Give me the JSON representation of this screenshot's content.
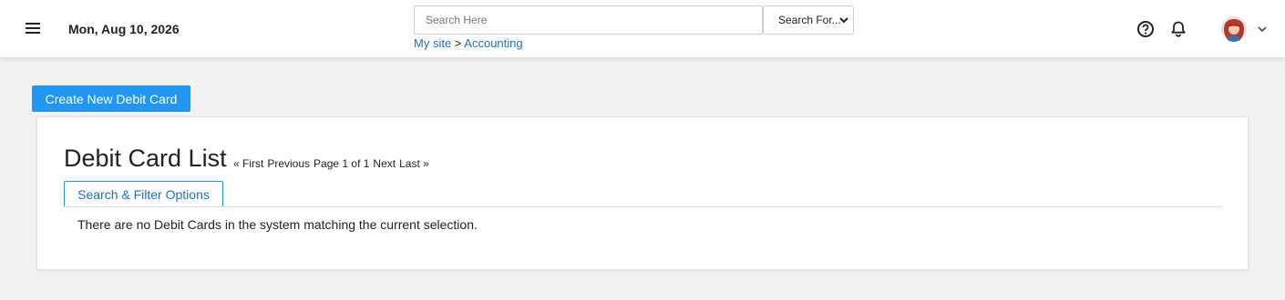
{
  "header": {
    "date": "Mon, Aug 10, 2026",
    "search_placeholder": "Search Here",
    "search_for_label": "Search For...",
    "breadcrumb": {
      "home": "My site",
      "separator": ">",
      "current": "Accounting"
    }
  },
  "icons": {
    "menu": "menu-icon",
    "help": "help-icon",
    "notifications": "bell-icon",
    "avatar": "user-avatar",
    "dropdown": "chevron-down-icon"
  },
  "colors": {
    "accent": "#2196f3",
    "link": "#1a73c9",
    "background": "#f2f2f2"
  },
  "main": {
    "create_button": "Create New Debit Card",
    "title": "Debit Card List",
    "pager": {
      "first": "« First",
      "previous": "Previous",
      "page_info": "Page 1 of 1",
      "next": "Next",
      "last": "Last »"
    },
    "filter_button": "Search & Filter Options",
    "empty_message": "There are no Debit Cards in the system matching the current selection."
  }
}
